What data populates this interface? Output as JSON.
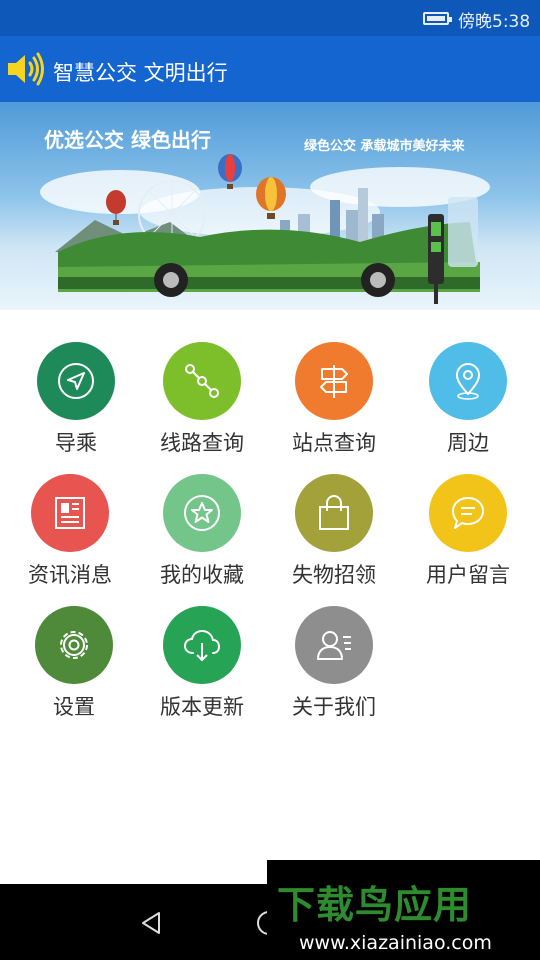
{
  "status_bar": {
    "time": "傍晚5:38",
    "battery_icon": "battery-icon"
  },
  "header": {
    "icon": "speaker-icon",
    "title": "智慧公交 文明出行",
    "background": "#1565d0"
  },
  "banner": {
    "title": "优选公交 绿色出行",
    "slogan": "绿色公交 承载城市美好未来"
  },
  "menu": [
    {
      "label": "导乘",
      "icon": "navigation-icon",
      "color": "#1e8a5a"
    },
    {
      "label": "线路查询",
      "icon": "route-icon",
      "color": "#7cbf2b"
    },
    {
      "label": "站点查询",
      "icon": "signpost-icon",
      "color": "#f07a2e"
    },
    {
      "label": "周边",
      "icon": "location-pin-icon",
      "color": "#4fbde8"
    },
    {
      "label": "资讯消息",
      "icon": "news-icon",
      "color": "#e85450"
    },
    {
      "label": "我的收藏",
      "icon": "star-icon",
      "color": "#74c58a"
    },
    {
      "label": "失物招领",
      "icon": "shopping-bag-icon",
      "color": "#a3a13a"
    },
    {
      "label": "用户留言",
      "icon": "message-icon",
      "color": "#f2c41a"
    },
    {
      "label": "设置",
      "icon": "gear-icon",
      "color": "#4e8a3a"
    },
    {
      "label": "版本更新",
      "icon": "cloud-download-icon",
      "color": "#27a356"
    },
    {
      "label": "关于我们",
      "icon": "contact-card-icon",
      "color": "#8e8e8e"
    }
  ],
  "nav_bar": {
    "back_icon": "back-icon",
    "home_icon": "home-icon"
  },
  "watermark": {
    "logo_text": "下载鸟应用",
    "url": "www.xiazainiao.com"
  }
}
